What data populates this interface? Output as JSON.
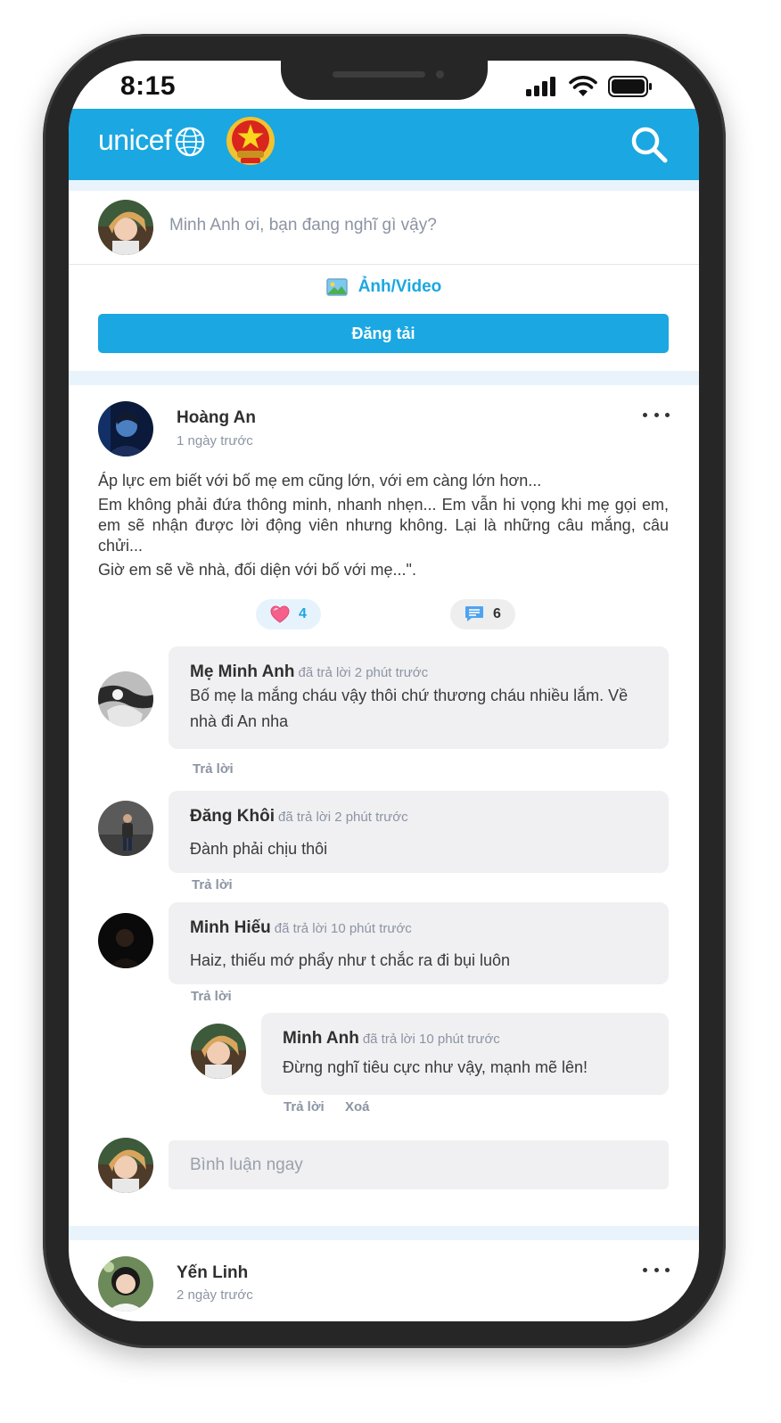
{
  "status_bar": {
    "time": "8:15"
  },
  "app_bar": {
    "logo_text": "unicef"
  },
  "composer": {
    "placeholder": "Minh Anh ơi, bạn đang nghĩ gì vậy?",
    "media_label": "Ảnh/Video",
    "post_button": "Đăng tải"
  },
  "post": {
    "author": "Hoàng An",
    "time": "1 ngày trước",
    "paragraphs": [
      "Áp lực em biết với bố mẹ em cũng lớn, với em càng lớn hơn...",
      "Em không phải đứa thông minh, nhanh nhẹn... Em vẫn hi vọng khi mẹ gọi em, em sẽ nhận được lời động viên nhưng không. Lại là những câu mắng, câu chửi...",
      "Giờ em sẽ về nhà, đối diện với bố với mẹ...\"."
    ],
    "like_count": "4",
    "comment_count": "6"
  },
  "comments": [
    {
      "name": "Mẹ Minh Anh",
      "meta": "đã trả lời 2 phút trước",
      "text": "Bố mẹ la mắng cháu vậy thôi chứ thương cháu nhiều lắm. Về nhà đi An nha",
      "reply": "Trả lời"
    },
    {
      "name": "Đăng Khôi",
      "meta": "đã trả lời 2 phút trước",
      "text": "Đành phải chịu thôi",
      "reply": "Trả lời"
    },
    {
      "name": "Minh Hiếu",
      "meta": "đã trả lời 10 phút trước",
      "text": "Haiz, thiếu mớ phẩy như t chắc ra đi bụi luôn",
      "reply": "Trả lời"
    }
  ],
  "nested_reply": {
    "name": "Minh Anh",
    "meta": "đã trả lời 10 phút trước",
    "text": "Đừng nghĩ tiêu cực như vậy, mạnh mẽ lên!",
    "reply": "Trả lời",
    "delete": "Xoá"
  },
  "comment_input": {
    "placeholder": "Bình luận ngay"
  },
  "next_post": {
    "author": "Yến Linh",
    "time": "2 ngày trước"
  },
  "colors": {
    "brand": "#1ba7e1",
    "band": "#e9f3fb",
    "bubble": "#f0f0f2",
    "muted": "#8b94a3"
  },
  "icons": [
    "signal-icon",
    "wifi-icon",
    "battery-icon",
    "unicef-globe-icon",
    "vietnam-emblem-icon",
    "search-icon",
    "image-icon",
    "more-icon",
    "heart-icon",
    "comment-icon"
  ]
}
